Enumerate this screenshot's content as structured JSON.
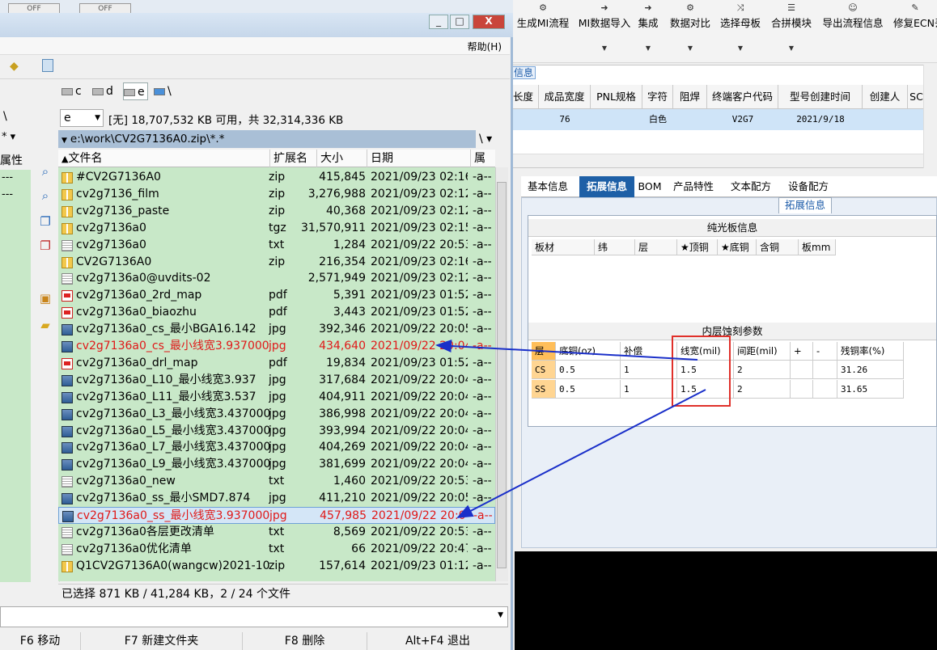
{
  "erp": {
    "toolbar": [
      {
        "label": "生成MI流程",
        "icon": "gear-icon",
        "has_dropdown": false
      },
      {
        "label": "MI数据导入",
        "icon": "import-icon",
        "has_dropdown": true
      },
      {
        "label": "集成",
        "icon": "integrate-icon",
        "has_dropdown": true
      },
      {
        "label": "数据对比",
        "icon": "compare-icon",
        "has_dropdown": true
      },
      {
        "label": "选择母板",
        "icon": "shuffle-icon",
        "has_dropdown": true
      },
      {
        "label": "合拼模块",
        "icon": "list-icon",
        "has_dropdown": true
      },
      {
        "label": "导出流程信息",
        "icon": "smile-icon",
        "has_dropdown": false
      },
      {
        "label": "修复ECN丢",
        "icon": "wrench-icon",
        "has_dropdown": false
      }
    ],
    "info_tab_stub": "信息",
    "grid": {
      "columns": [
        "长度",
        "成品宽度",
        "PNL规格",
        "字符",
        "阻焊",
        "终端客户代码",
        "型号创建时间",
        "创建人",
        "SC"
      ],
      "row": [
        "",
        "76",
        "",
        "白色",
        "",
        "V2G7",
        "2021/9/18",
        "",
        ""
      ]
    },
    "tabs": [
      "基本信息",
      "拓展信息",
      "BOM",
      "产品特性",
      "文本配方",
      "设备配方"
    ],
    "active_tab": "拓展信息",
    "expand_title": "拓展信息",
    "plain_board": {
      "title": "纯光板信息",
      "columns": [
        "板材",
        "纬",
        "层",
        "★顶铜",
        "★底铜",
        "含铜",
        "板mm"
      ]
    },
    "inner_etch": {
      "title": "内层蚀刻参数",
      "columns": [
        "层",
        "底铜(oz)",
        "补偿",
        "线宽(mil)",
        "间距(mil)",
        "+",
        "-",
        "残铜率(%)"
      ],
      "rows": [
        [
          "CS",
          "0.5",
          "1",
          "1.5",
          "2",
          "",
          "",
          "31.26"
        ],
        [
          "SS",
          "0.5",
          "1",
          "1.5",
          "2",
          "",
          "",
          "31.65"
        ]
      ]
    }
  },
  "fm": {
    "off_labels": [
      "OFF",
      "OFF"
    ],
    "menu_help": "帮助(H)",
    "window_buttons": [
      "_",
      "□",
      "X"
    ],
    "drives": [
      "c",
      "d",
      "e",
      "\\"
    ],
    "selected_drive": "e",
    "drive_combo": "e",
    "free_space": "[无]  18,707,532 KB 可用，共 32,314,336 KB",
    "path": "e:\\work\\CV2G7136A0.zip\\*.*",
    "path_right": "\\  ▾",
    "left_stub": {
      "col": "属性",
      "rows": [
        "---",
        "---"
      ],
      "top": "\\",
      "star": "* ▾"
    },
    "columns": [
      "文件名",
      "扩展名",
      "大小",
      "日期",
      "属性"
    ],
    "files": [
      {
        "name": "#CV2G7136A0",
        "ext": "zip",
        "size": "415,845",
        "date": "2021/09/23 02:16",
        "attr": "-a--",
        "icon": "zip"
      },
      {
        "name": "cv2g7136_film",
        "ext": "zip",
        "size": "3,276,988",
        "date": "2021/09/23 02:12",
        "attr": "-a--",
        "icon": "zip"
      },
      {
        "name": "cv2g7136_paste",
        "ext": "zip",
        "size": "40,368",
        "date": "2021/09/23 02:12",
        "attr": "-a--",
        "icon": "zip"
      },
      {
        "name": "cv2g7136a0",
        "ext": "tgz",
        "size": "31,570,911",
        "date": "2021/09/23 02:15",
        "attr": "-a--",
        "icon": "zip"
      },
      {
        "name": "cv2g7136a0",
        "ext": "txt",
        "size": "1,284",
        "date": "2021/09/22 20:53",
        "attr": "-a--",
        "icon": "txt"
      },
      {
        "name": "CV2G7136A0",
        "ext": "zip",
        "size": "216,354",
        "date": "2021/09/23 02:16",
        "attr": "-a--",
        "icon": "zip"
      },
      {
        "name": "cv2g7136a0@uvdits-02",
        "ext": "",
        "size": "2,571,949",
        "date": "2021/09/23 02:12",
        "attr": "-a--",
        "icon": "txt"
      },
      {
        "name": "cv2g7136a0_2rd_map",
        "ext": "pdf",
        "size": "5,391",
        "date": "2021/09/23 01:52",
        "attr": "-a--",
        "icon": "pdf"
      },
      {
        "name": "cv2g7136a0_biaozhu",
        "ext": "pdf",
        "size": "3,443",
        "date": "2021/09/23 01:52",
        "attr": "-a--",
        "icon": "pdf"
      },
      {
        "name": "cv2g7136a0_cs_最小BGA16.142",
        "ext": "jpg",
        "size": "392,346",
        "date": "2021/09/22 20:05",
        "attr": "-a--",
        "icon": "jpg"
      },
      {
        "name": "cv2g7136a0_cs_最小线宽3.937000..",
        "ext": "jpg",
        "size": "434,640",
        "date": "2021/09/22 20:04",
        "attr": "-a--",
        "icon": "jpg",
        "red": true
      },
      {
        "name": "cv2g7136a0_drl_map",
        "ext": "pdf",
        "size": "19,834",
        "date": "2021/09/23 01:52",
        "attr": "-a--",
        "icon": "pdf"
      },
      {
        "name": "cv2g7136a0_L10_最小线宽3.937",
        "ext": "jpg",
        "size": "317,684",
        "date": "2021/09/22 20:04",
        "attr": "-a--",
        "icon": "jpg"
      },
      {
        "name": "cv2g7136a0_L11_最小线宽3.537",
        "ext": "jpg",
        "size": "404,911",
        "date": "2021/09/22 20:04",
        "attr": "-a--",
        "icon": "jpg"
      },
      {
        "name": "cv2g7136a0_L3_最小线宽3.437000..",
        "ext": "jpg",
        "size": "386,998",
        "date": "2021/09/22 20:04",
        "attr": "-a--",
        "icon": "jpg"
      },
      {
        "name": "cv2g7136a0_L5_最小线宽3.437000..",
        "ext": "jpg",
        "size": "393,994",
        "date": "2021/09/22 20:04",
        "attr": "-a--",
        "icon": "jpg"
      },
      {
        "name": "cv2g7136a0_L7_最小线宽3.437000..",
        "ext": "jpg",
        "size": "404,269",
        "date": "2021/09/22 20:04",
        "attr": "-a--",
        "icon": "jpg"
      },
      {
        "name": "cv2g7136a0_L9_最小线宽3.437000..",
        "ext": "jpg",
        "size": "381,699",
        "date": "2021/09/22 20:04",
        "attr": "-a--",
        "icon": "jpg"
      },
      {
        "name": "cv2g7136a0_new",
        "ext": "txt",
        "size": "1,460",
        "date": "2021/09/22 20:53",
        "attr": "-a--",
        "icon": "txt"
      },
      {
        "name": "cv2g7136a0_ss_最小SMD7.874",
        "ext": "jpg",
        "size": "411,210",
        "date": "2021/09/22 20:05",
        "attr": "-a--",
        "icon": "jpg"
      },
      {
        "name": "cv2g7136a0_ss_最小线宽3.937000..",
        "ext": "jpg",
        "size": "457,985",
        "date": "2021/09/22 20:04",
        "attr": "-a--",
        "icon": "jpg",
        "red": true,
        "selected": true
      },
      {
        "name": "cv2g7136a0各层更改清单",
        "ext": "txt",
        "size": "8,569",
        "date": "2021/09/22 20:53",
        "attr": "-a--",
        "icon": "txt"
      },
      {
        "name": "cv2g7136a0优化清单",
        "ext": "txt",
        "size": "66",
        "date": "2021/09/22 20:47",
        "attr": "-a--",
        "icon": "txt"
      },
      {
        "name": "Q1CV2G7136A0(wangcw)2021-10-..",
        "ext": "zip",
        "size": "157,614",
        "date": "2021/09/23 01:12",
        "attr": "-a--",
        "icon": "zip"
      }
    ],
    "status": "已选择 871 KB / 41,284 KB，2 / 24 个文件",
    "fkeys": [
      "F6 移动",
      "F7 新建文件夹",
      "F8 删除",
      "Alt+F4 退出"
    ]
  },
  "colors": {
    "accent": "#1d5fa6",
    "list_bg": "#c8e8c8",
    "highlight_red": "#e01818",
    "arrow": "#1a2fc9"
  }
}
